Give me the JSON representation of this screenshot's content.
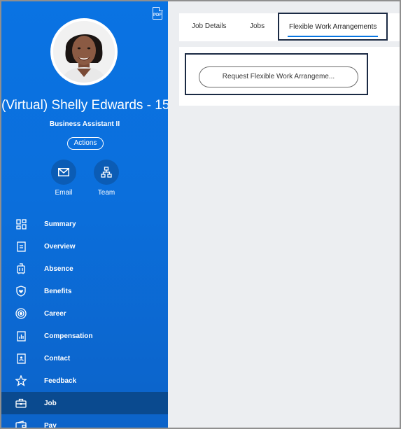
{
  "worker": {
    "name": "(Virtual) Shelly Edwards - 15",
    "title": "Business Assistant II",
    "actions_label": "Actions"
  },
  "header": {
    "pdf_label": "PDF"
  },
  "quick_actions": [
    {
      "label": "Email",
      "icon": "email-icon"
    },
    {
      "label": "Team",
      "icon": "org-chart-icon"
    }
  ],
  "sidebar": {
    "items": [
      {
        "label": "Summary",
        "icon": "summary-grid-icon"
      },
      {
        "label": "Overview",
        "icon": "overview-doc-icon"
      },
      {
        "label": "Absence",
        "icon": "luggage-icon"
      },
      {
        "label": "Benefits",
        "icon": "shield-heart-icon"
      },
      {
        "label": "Career",
        "icon": "target-icon"
      },
      {
        "label": "Compensation",
        "icon": "bar-chart-icon"
      },
      {
        "label": "Contact",
        "icon": "contact-book-icon"
      },
      {
        "label": "Feedback",
        "icon": "star-icon"
      },
      {
        "label": "Job",
        "icon": "briefcase-icon",
        "active": true
      },
      {
        "label": "Pay",
        "icon": "wallet-icon"
      }
    ]
  },
  "tabs": [
    {
      "label": "Job Details"
    },
    {
      "label": "Jobs"
    },
    {
      "label": "Flexible Work Arrangements",
      "active": true
    }
  ],
  "main": {
    "request_button_label": "Request Flexible Work Arrangeme..."
  },
  "colors": {
    "sidebar_top": "#0a73e3",
    "sidebar_active": "#0a4a8f",
    "focus_outline": "#1b2a44",
    "tab_underline": "#0875e1",
    "main_bg": "#eceef1"
  }
}
